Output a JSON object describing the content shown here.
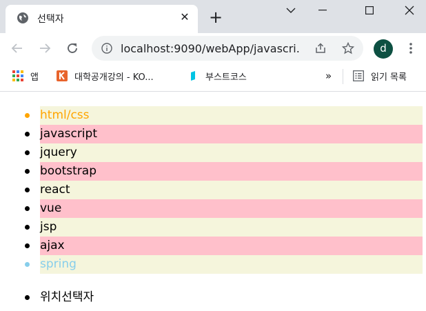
{
  "tab": {
    "title": "선택자",
    "favicon": "globe-icon"
  },
  "window": {
    "controls": [
      "chevron-down-icon",
      "minimize-icon",
      "maximize-icon",
      "close-icon"
    ]
  },
  "toolbar": {
    "url": "localhost:9090/webApp/javascri...",
    "avatar_letter": "d"
  },
  "bookmarks": {
    "items": [
      {
        "label": "앱",
        "icon": "apps-grid-icon"
      },
      {
        "label": "대학공개강의 - KO...",
        "icon": "kocw-icon"
      },
      {
        "label": "부스트코스",
        "icon": "boostcourse-icon"
      }
    ],
    "more": "»",
    "reading_list": "읽기 목록"
  },
  "list": {
    "items": [
      "html/css",
      "javascript",
      "jquery",
      "bootstrap",
      "react",
      "vue",
      "jsp",
      "ajax",
      "spring"
    ]
  },
  "list2": {
    "items": [
      "위치선택자"
    ]
  },
  "colors": {
    "odd_bg": "#f5f5dc",
    "even_bg": "#ffc0cb",
    "first": "#ffa500",
    "last": "#87ceeb"
  }
}
